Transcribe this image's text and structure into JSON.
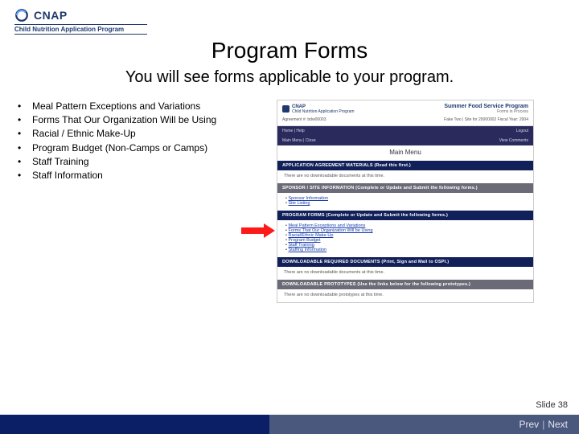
{
  "logo": {
    "brand": "CNAP",
    "sub": "Child Nutrition Application Program"
  },
  "title": "Program Forms",
  "subtitle": "You will see forms applicable to your program.",
  "bullets": [
    "Meal Pattern Exceptions and Variations",
    "Forms That Our Organization Will be Using",
    "Racial / Ethnic Make-Up",
    "Program Budget (Non-Camps or Camps)",
    "Staff Training",
    "Staff Information"
  ],
  "mock": {
    "brand": "CNAP",
    "brand_sub": "Child Nutrition Application Program",
    "summer": "Summer Food Service Program",
    "summer_sub": "Forms in Process",
    "agreement": "Agreement #: bdw00003",
    "meta_right": "Fake Two | Site for 20000002        Fiscal Year: 2004",
    "nav_left": "Home | Help",
    "nav_logout": "Logout",
    "nav2_left": "Main Menu | Close",
    "nav2_right": "View Comments",
    "main_menu": "Main Menu",
    "bar_app": "APPLICATION AGREEMENT MATERIALS (Read this first.)",
    "app_body": "There are no downloadable documents at this time.",
    "bar_sponsor": "SPONSOR / SITE INFORMATION (Complete or Update and Submit the following forms.)",
    "sponsor_items": [
      "Sponsor Information",
      "Site Listing"
    ],
    "bar_forms": "PROGRAM FORMS (Complete or Update and Submit the following forms.)",
    "form_items": [
      "Meal Pattern Exceptions and Variations",
      "Forms That Our Organization Will be Using",
      "Racial/Ethnic Make-Up",
      "Program Budget",
      "Staff Training",
      "Staffing Information"
    ],
    "bar_dl": "DOWNLOADABLE REQUIRED DOCUMENTS (Print, Sign and Mail to OSPI.)",
    "dl_body": "There are no downloadable documents at this time.",
    "bar_proto": "DOWNLOADABLE PROTOTYPES (Use the links below for the following prototypes.)",
    "proto_body": "There are no downloadable prototypes at this time."
  },
  "slide_label": "Slide 38",
  "nav": {
    "prev": "Prev",
    "sep": "|",
    "next": "Next"
  }
}
